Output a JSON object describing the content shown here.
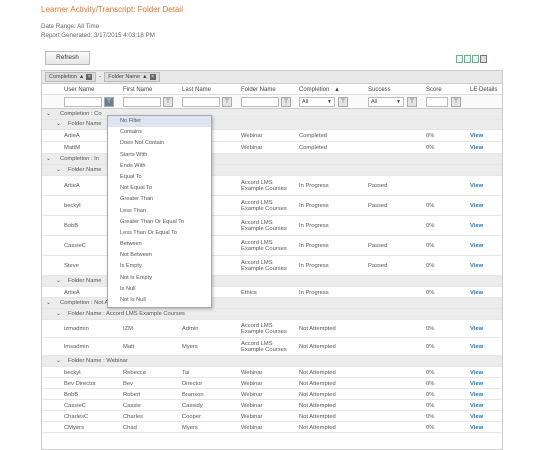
{
  "page": {
    "title": "Learner Activity/Transcript: Folder Detail",
    "date_range": "Date Range: All Time",
    "report_generated": "Report Generated: 3/17/2015 4:03:18 PM",
    "refresh": "Refresh"
  },
  "group_chips": [
    "Completion",
    "Folder Name"
  ],
  "columns": [
    "User Name",
    "First Name",
    "Last Name",
    "Folder Name",
    "Completion",
    "Success",
    "Score",
    "LE Details"
  ],
  "filters": {
    "completion": "All",
    "success": "All"
  },
  "filter_menu": [
    "No Filter",
    "Contains",
    "Does Not Contain",
    "Starts With",
    "Ends With",
    "Equal To",
    "Not Equal To",
    "Greater Than",
    "Less Than",
    "Greater Than Or Equal To",
    "Less Than Or Equal To",
    "Between",
    "Not Between",
    "Is Empty",
    "Not Is Empty",
    "Is Null",
    "Not Is Null"
  ],
  "groups": {
    "g_completed": "Completion : Co",
    "g_completed_folder": "Folder Name",
    "g_inprogress": "Completion : In",
    "g_inprogress_folder": "Folder Name",
    "g_inprogress_folder2": "Folder Name",
    "g_notattempted": "Completion : Not Attempted",
    "g_na_folder_accord": "Folder Name : Accord LMS Example Courses",
    "g_na_folder_webinar": "Folder Name : Webinar"
  },
  "rows_completed": [
    {
      "user": "ArtieA",
      "folder": "Webinar",
      "completion": "Completed",
      "score": "0%",
      "link": "View"
    },
    {
      "user": "MattM",
      "folder": "Webinar",
      "completion": "Completed",
      "score": "0%",
      "link": "View"
    }
  ],
  "rows_inprogress": [
    {
      "user": "ArtieA",
      "folder": "Accord LMS Example Courses",
      "completion": "In Progress",
      "success": "Passed",
      "score": "",
      "link": "View"
    },
    {
      "user": "beckyt",
      "folder": "Accord LMS Example Courses",
      "completion": "In Progress",
      "success": "Passed",
      "score": "0%",
      "link": "View"
    },
    {
      "user": "BobB",
      "folder": "Accord LMS Example Courses",
      "completion": "In Progress",
      "success": "",
      "score": "0%",
      "link": "View"
    },
    {
      "user": "CassieC",
      "folder": "Accord LMS Example Courses",
      "completion": "In Progress",
      "success": "Passed",
      "score": "0%",
      "link": "View"
    },
    {
      "user": "Steve",
      "folder": "Accord LMS Example Courses",
      "completion": "In Progress",
      "success": "Passed",
      "score": "0%",
      "link": "View"
    }
  ],
  "rows_inprogress2": [
    {
      "user": "ArtieA",
      "folder": "Ethics",
      "completion": "In Progress",
      "score": "0%",
      "link": "View"
    }
  ],
  "rows_na_accord": [
    {
      "user": "izmadmin",
      "first": "IZM",
      "last": "Admin",
      "folder": "Accord LMS Example Courses",
      "completion": "Not Attempted",
      "score": "0%",
      "link": "View"
    },
    {
      "user": "lmsadmin",
      "first": "Matt",
      "last": "Myers",
      "folder": "Accord LMS Example Courses",
      "completion": "Not Attempted",
      "score": "0%",
      "link": "View"
    }
  ],
  "rows_na_webinar": [
    {
      "user": "beckyt",
      "first": "Rebecca",
      "last": "Tai",
      "folder": "Webinar",
      "completion": "Not Attempted",
      "score": "0%",
      "link": "View"
    },
    {
      "user": "Bev Director",
      "first": "Bev",
      "last": "Director",
      "folder": "Webinar",
      "completion": "Not Attempted",
      "score": "0%",
      "link": "View"
    },
    {
      "user": "BobB",
      "first": "Robert",
      "last": "Branson",
      "folder": "Webinar",
      "completion": "Not Attempted",
      "score": "0%",
      "link": "View"
    },
    {
      "user": "CassieC",
      "first": "Cassie",
      "last": "Cassidy",
      "folder": "Webinar",
      "completion": "Not Attempted",
      "score": "0%",
      "link": "View"
    },
    {
      "user": "CharlesC",
      "first": "Charles",
      "last": "Cooper",
      "folder": "Webinar",
      "completion": "Not Attempted",
      "score": "0%",
      "link": "View"
    },
    {
      "user": "CMyers",
      "first": "Chad",
      "last": "Myers",
      "folder": "Webinar",
      "completion": "Not Attempted",
      "score": "0%",
      "link": "View"
    }
  ]
}
